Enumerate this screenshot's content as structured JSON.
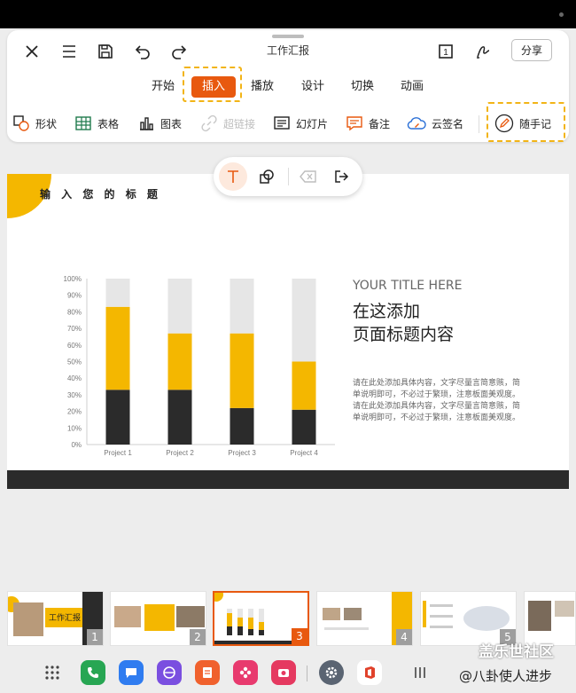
{
  "toolbar": {
    "doc_title": "工作汇报",
    "share_label": "分享",
    "page_badge": "1",
    "tabs": [
      {
        "label": "开始"
      },
      {
        "label": "插入"
      },
      {
        "label": "播放"
      },
      {
        "label": "设计"
      },
      {
        "label": "切换"
      },
      {
        "label": "动画"
      }
    ],
    "active_tab": "插入",
    "tools": [
      {
        "label": "形状",
        "icon": "shapes-icon"
      },
      {
        "label": "表格",
        "icon": "table-icon"
      },
      {
        "label": "图表",
        "icon": "chart-icon"
      },
      {
        "label": "超链接",
        "icon": "link-icon",
        "disabled": true
      },
      {
        "label": "幻灯片",
        "icon": "slides-icon"
      },
      {
        "label": "备注",
        "icon": "note-icon"
      },
      {
        "label": "云签名",
        "icon": "cloud-sign-icon"
      },
      {
        "label": "随手记",
        "icon": "pencil-icon"
      }
    ],
    "accent": "#e8590f",
    "highlight": "#f2b416"
  },
  "slide": {
    "heading": "输 入 您 的 标 题",
    "title_en": "YOUR TITLE HERE",
    "title_cn_1": "在这添加",
    "title_cn_2": "页面标题内容",
    "body_lines": [
      "请在此处添加具体内容，文字尽量言简意赅，简",
      "单说明即可，不必过于繁琐，注意板面美观度。",
      "请在此处添加具体内容，文字尽量言简意赅，简",
      "单说明即可，不必过于繁琐，注意板面美观度。"
    ],
    "colors": {
      "yellow": "#f4b700",
      "dark": "#2b2b2b",
      "gray": "#e6e6e6"
    }
  },
  "chart_data": {
    "type": "bar",
    "stacked": true,
    "categories": [
      "Project 1",
      "Project 2",
      "Project 3",
      "Project 4"
    ],
    "series": [
      {
        "color": "#2b2b2b",
        "values": [
          33,
          33,
          22,
          21
        ]
      },
      {
        "color": "#f4b700",
        "values": [
          50,
          34,
          45,
          29
        ]
      },
      {
        "color": "#e6e6e6",
        "values": [
          17,
          33,
          33,
          50
        ]
      }
    ],
    "yticks": [
      "0%",
      "10%",
      "20%",
      "30%",
      "40%",
      "50%",
      "60%",
      "70%",
      "80%",
      "90%",
      "100%"
    ],
    "ylim": [
      0,
      100
    ]
  },
  "thumbnails": [
    {
      "number": "1",
      "title": "工作汇报"
    },
    {
      "number": "2"
    },
    {
      "number": "3",
      "selected": true
    },
    {
      "number": "4"
    },
    {
      "number": "5"
    }
  ],
  "watermark": {
    "line1": "盖乐世社区",
    "line2": "@八卦使人进步"
  }
}
